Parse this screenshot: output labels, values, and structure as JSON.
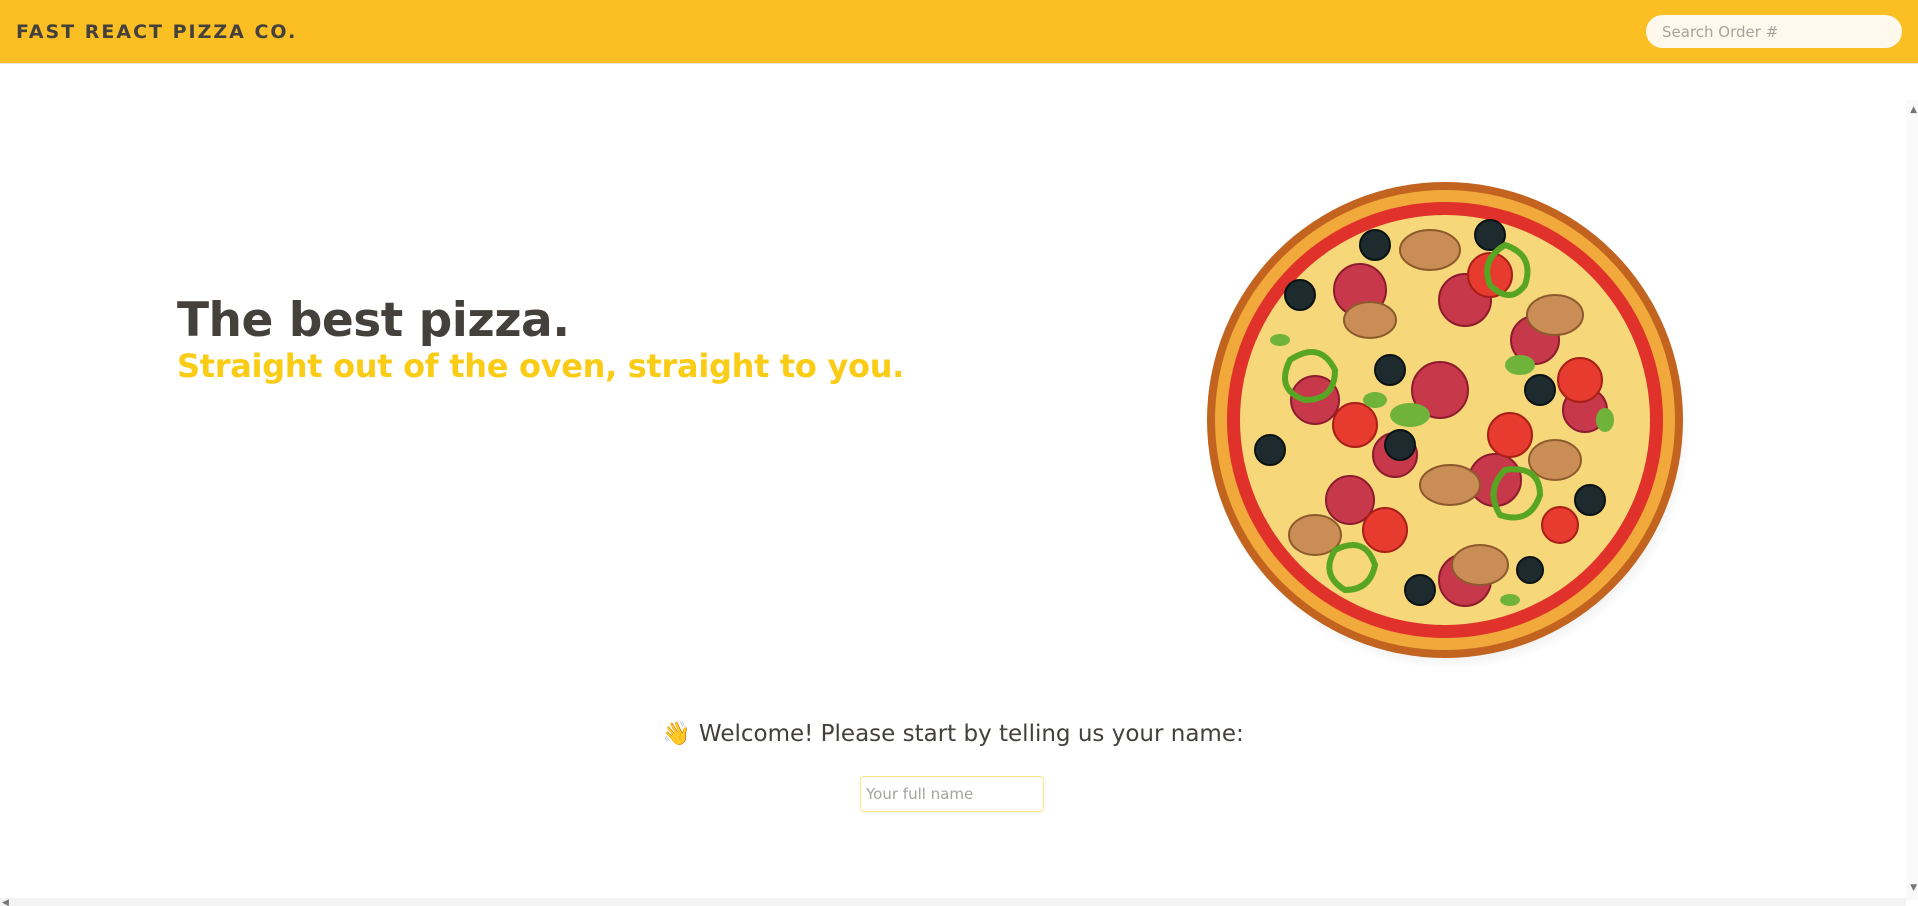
{
  "header": {
    "logo": "Fast React Pizza Co.",
    "search_placeholder": "Search Order #"
  },
  "hero": {
    "title": "The best pizza.",
    "subtitle": "Straight out of the oven, straight to you."
  },
  "welcome": {
    "emoji": "👋",
    "text": "Welcome! Please start by telling us your name:"
  },
  "name_input": {
    "placeholder": "Your full name",
    "value": ""
  },
  "colors": {
    "header_bg": "#fbbf24",
    "accent": "#facc15",
    "text": "#44403c"
  },
  "icons": {
    "pizza": "pizza-illustration",
    "wave": "waving-hand-icon"
  }
}
